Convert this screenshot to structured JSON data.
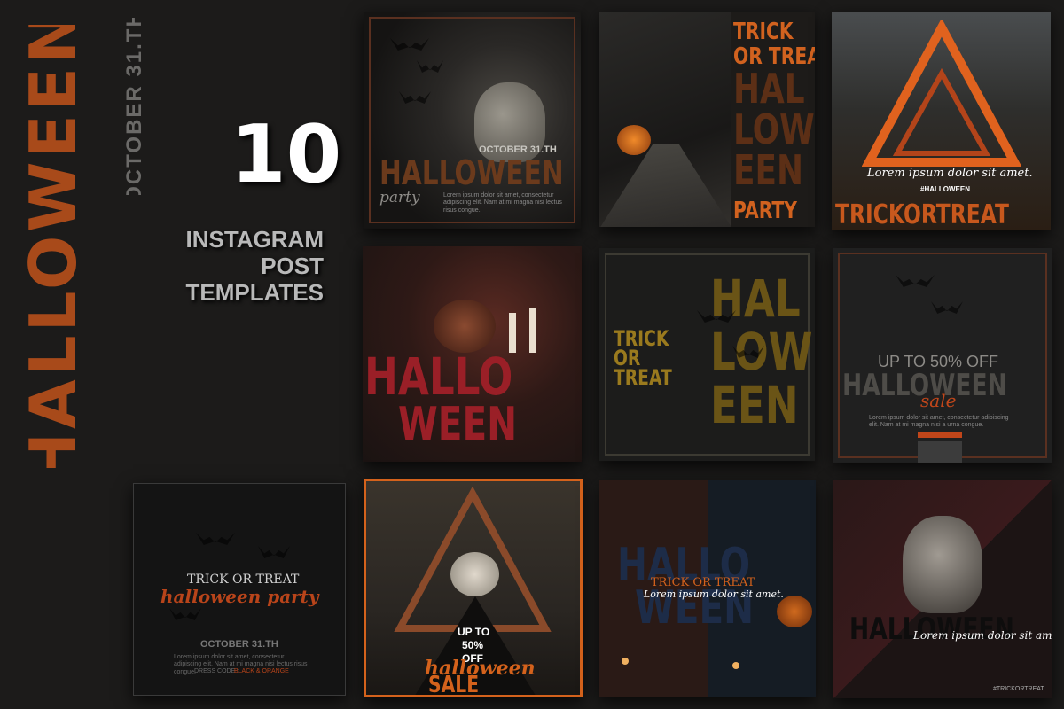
{
  "side_title": "HALLOWEEN",
  "side_date": "OCTOBER 31.TH",
  "count": "10",
  "subtitle_lines": [
    "INSTAGRAM",
    "POST",
    "TEMPLATES"
  ],
  "colors": {
    "accent": "#a84a1a",
    "bg": "#1c1b1a",
    "crimson": "#8b1a22",
    "mustard": "#9a7a1e"
  },
  "cards": {
    "c1": {
      "date": "OCTOBER 31.TH",
      "title": "HALLOWEEN",
      "script": "party",
      "body": "Lorem ipsum dolor sit amet, consectetur adipiscing elit. Nam at mi magna nisi lectus risus congue."
    },
    "c2": {
      "line1": "TRICK",
      "line2": "OR TREAT",
      "big": [
        "HAL",
        "LOW",
        "EEN"
      ],
      "tag": "PARTY"
    },
    "c3": {
      "script": "Lorem ipsum dolor sit amet.",
      "hashtag": "#HALLOWEEN",
      "bottom": "TRICKORTREAT"
    },
    "c4": {
      "line1": "HALLO",
      "line2": "WEEN"
    },
    "c5": {
      "left": [
        "TRICK",
        "OR",
        "TREAT"
      ],
      "right": [
        "HAL",
        "LOW",
        "EEN"
      ]
    },
    "c6": {
      "offer": "UP TO 50% OFF",
      "title": "HALLOWEEN",
      "script": "sale",
      "body": "Lorem ipsum dolor sit amet, consectetur adipiscing elit. Nam at mi magna nisi a urna congue."
    },
    "c7": {
      "line1": "TRICK OR TREAT",
      "script": "halloween party",
      "date": "OCTOBER 31.TH",
      "body": "Lorem ipsum dolor sit amet, consectetur adipiscing elit. Nam at mi magna nisi lectus risus congue.",
      "dress_label": "DRESS CODE :",
      "dress_value": "BLACK & ORANGE"
    },
    "c8": {
      "up": "UP TO",
      "pct": "50%",
      "off": "OFF",
      "script": "halloween",
      "sale": "SALE"
    },
    "c9": {
      "big1": "HALLO",
      "big2": "WEEN",
      "line": "TRICK OR TREAT",
      "script": "Lorem ipsum dolor sit amet."
    },
    "c10": {
      "title": "HALLOWEEN",
      "script": "Lorem ipsum dolor sit amet.",
      "hashtag": "#TRICKORTREAT"
    }
  }
}
